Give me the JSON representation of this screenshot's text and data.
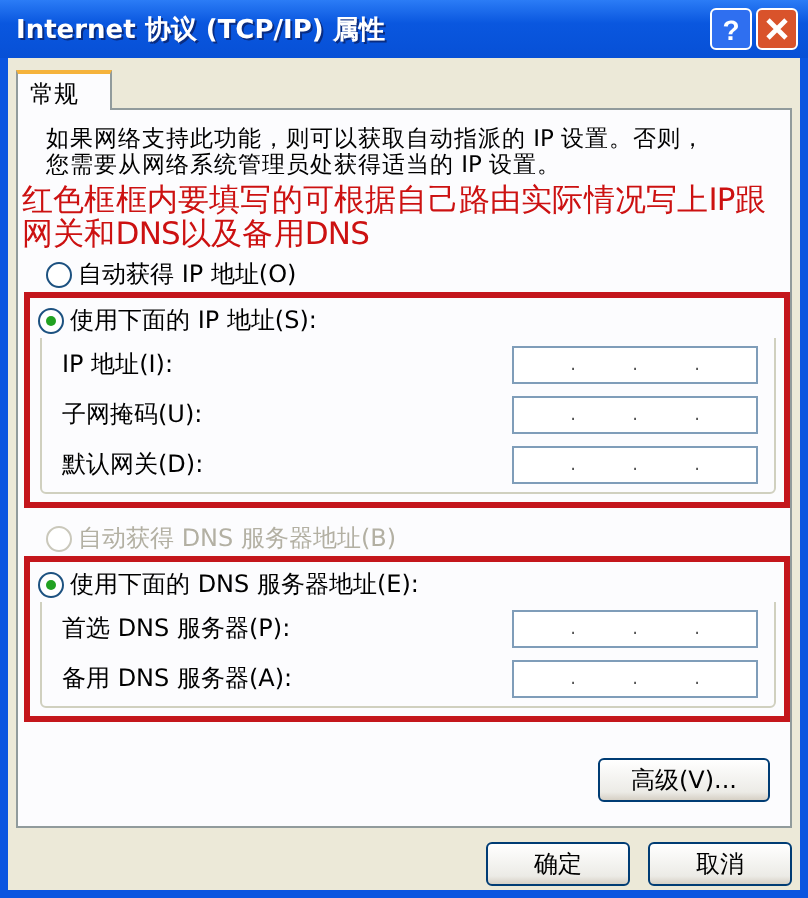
{
  "window": {
    "title": "Internet 协议 (TCP/IP) 属性",
    "help_button": "?"
  },
  "tabs": [
    {
      "label": "常规",
      "selected": true
    }
  ],
  "intro": [
    "如果网络支持此功能，则可以获取自动指派的 IP 设置。否则，",
    "您需要从网络系统管理员处获得适当的 IP 设置。"
  ],
  "annotation": "红色框框内要填写的可根据自己路由实际情况写上IP跟网关和DNS以及备用DNS",
  "ip_auto": {
    "label": "自动获得 IP 地址(O)",
    "selected": false,
    "disabled": false
  },
  "ip_group": {
    "label": "使用下面的 IP 地址(S):",
    "selected": true,
    "disabled": false,
    "highlighted": true,
    "fields": [
      {
        "label": "IP 地址(I):",
        "separators": [
          ".",
          ".",
          "."
        ]
      },
      {
        "label": "子网掩码(U):",
        "separators": [
          ".",
          ".",
          "."
        ]
      },
      {
        "label": "默认网关(D):",
        "separators": [
          ".",
          ".",
          "."
        ]
      }
    ]
  },
  "dns_auto": {
    "label": "自动获得 DNS 服务器地址(B)",
    "selected": false,
    "disabled": true
  },
  "dns_group": {
    "label": "使用下面的 DNS 服务器地址(E):",
    "selected": true,
    "disabled": false,
    "highlighted": true,
    "fields": [
      {
        "label": "首选 DNS 服务器(P):",
        "separators": [
          ".",
          ".",
          "."
        ]
      },
      {
        "label": "备用 DNS 服务器(A):",
        "separators": [
          ".",
          ".",
          "."
        ]
      }
    ]
  },
  "advanced_button": "高级(V)...",
  "buttons": [
    "确定",
    "取消"
  ]
}
